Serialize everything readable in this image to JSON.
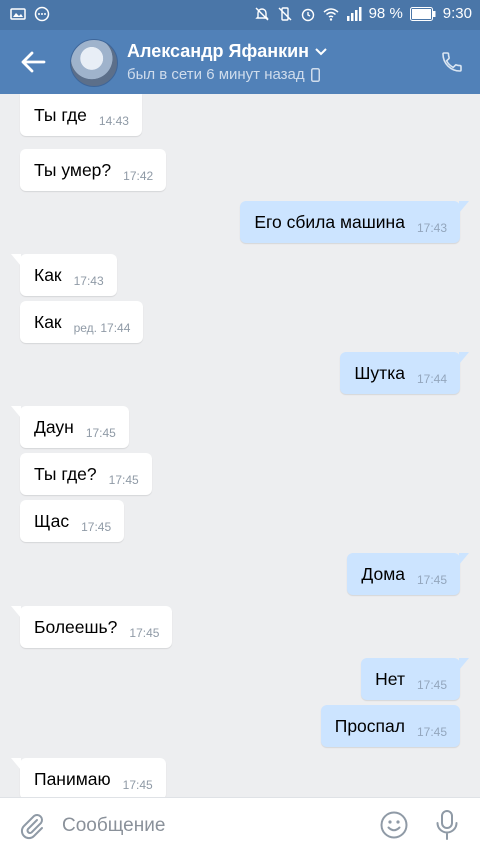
{
  "status_bar": {
    "battery_text": "98 %",
    "time": "9:30"
  },
  "header": {
    "contact_name": "Александр Яфанкин",
    "contact_status": "был в сети 6 минут назад"
  },
  "messages": [
    {
      "dir": "in",
      "text": "Ты где",
      "time": "14:43",
      "tail": false
    },
    {
      "dir": "in",
      "text": "Ты умер?",
      "time": "17:42",
      "tail": false
    },
    {
      "dir": "out",
      "text": "Его сбила машина",
      "time": "17:43",
      "tail": true
    },
    {
      "dir": "in",
      "text": "Как",
      "time": "17:43",
      "tail": true
    },
    {
      "dir": "in",
      "text": "Как",
      "time": "ред. 17:44",
      "tail": false
    },
    {
      "dir": "out",
      "text": "Шутка",
      "time": "17:44",
      "tail": true
    },
    {
      "dir": "in",
      "text": "Даун",
      "time": "17:45",
      "tail": true
    },
    {
      "dir": "in",
      "text": "Ты где?",
      "time": "17:45",
      "tail": false
    },
    {
      "dir": "in",
      "text": "Щас",
      "time": "17:45",
      "tail": false
    },
    {
      "dir": "out",
      "text": "Дома",
      "time": "17:45",
      "tail": true
    },
    {
      "dir": "in",
      "text": "Болеешь?",
      "time": "17:45",
      "tail": true
    },
    {
      "dir": "out",
      "text": "Нет",
      "time": "17:45",
      "tail": true
    },
    {
      "dir": "out",
      "text": "Проспал",
      "time": "17:45",
      "tail": false
    },
    {
      "dir": "in",
      "text": "Панимаю",
      "time": "17:45",
      "tail": true
    }
  ],
  "composer": {
    "placeholder": "Сообщение"
  },
  "colors": {
    "header": "#5181b8",
    "status_bar": "#4a76a8",
    "background": "#edeef0",
    "incoming_bubble": "#ffffff",
    "outgoing_bubble": "#cce4ff"
  },
  "icons": {
    "back": "arrow-left-icon",
    "call": "phone-icon",
    "attach": "paperclip-icon",
    "emoji": "smile-icon",
    "voice": "microphone-icon"
  }
}
